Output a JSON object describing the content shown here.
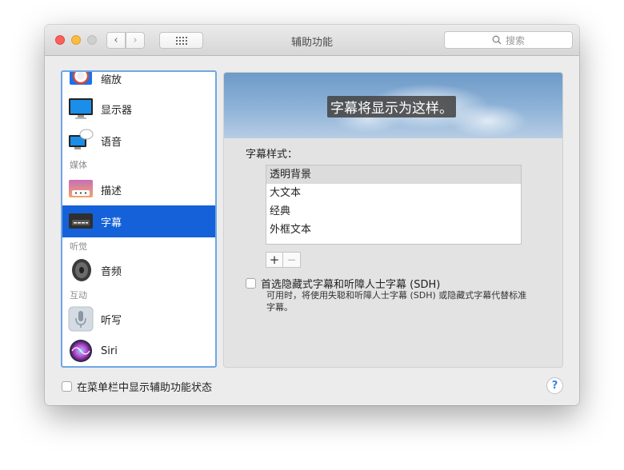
{
  "window": {
    "title": "辅助功能",
    "search_placeholder": "搜索"
  },
  "sidebar": {
    "items": [
      {
        "label": "缩放",
        "icon": "zoom-icon"
      },
      {
        "label": "显示器",
        "icon": "display-icon"
      },
      {
        "label": "语音",
        "icon": "speech-icon"
      },
      {
        "label": "描述",
        "icon": "descriptions-icon"
      },
      {
        "label": "字幕",
        "icon": "captions-icon",
        "selected": true
      },
      {
        "label": "音频",
        "icon": "audio-icon"
      },
      {
        "label": "听写",
        "icon": "dictation-icon"
      },
      {
        "label": "Siri",
        "icon": "siri-icon"
      }
    ],
    "sections": {
      "media": "媒体",
      "hearing": "听觉",
      "interaction": "互动"
    }
  },
  "panel": {
    "preview_caption": "字幕将显示为这样。",
    "style_label": "字幕样式：",
    "styles": [
      "透明背景",
      "大文本",
      "经典",
      "外框文本"
    ],
    "selected_style": "透明背景",
    "plus_label": "+",
    "minus_label": "−",
    "sdh_checkbox_label": "首选隐藏式字幕和听障人士字幕 (SDH)",
    "sdh_note": "可用时，将使用失聪和听障人士字幕 (SDH) 或隐藏式字幕代替标准字幕。"
  },
  "footer": {
    "menu_bar_checkbox_label": "在菜单栏中显示辅助功能状态",
    "help_label": "?"
  },
  "colors": {
    "selection": "#1561d9",
    "sidebar_focus_ring": "#6fa6e6",
    "close": "#fc605c",
    "minimize": "#fdbc40"
  }
}
